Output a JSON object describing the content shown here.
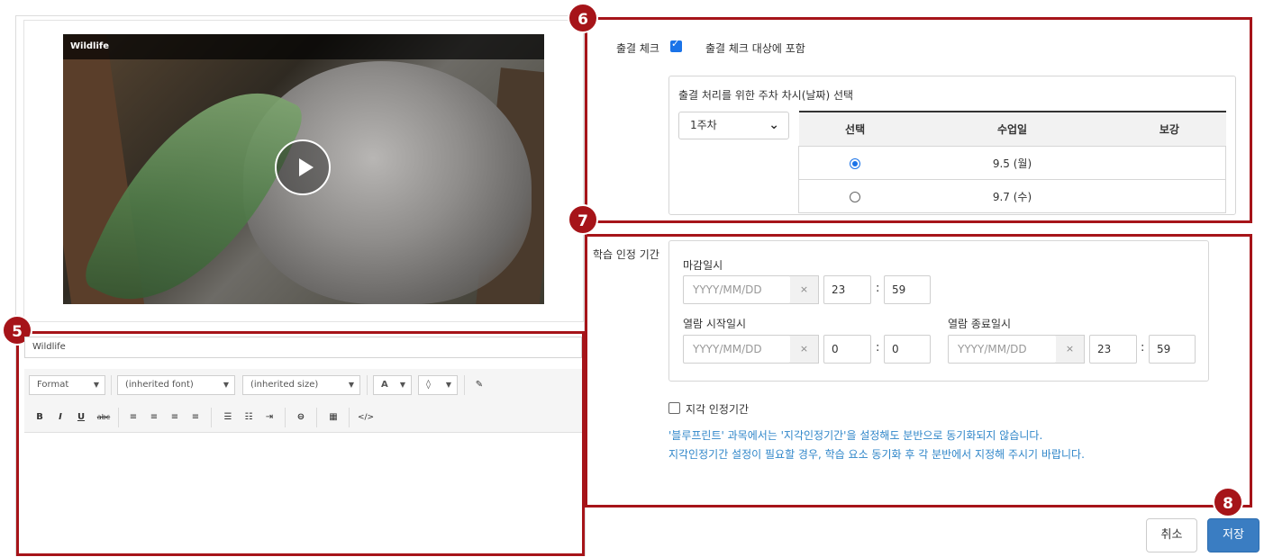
{
  "video": {
    "title": "Wildlife"
  },
  "editor": {
    "title_value": "Wildlife",
    "format_label": "Format",
    "font_label": "(inherited font)",
    "size_label": "(inherited size)",
    "text_color_label": "A",
    "bold": "B",
    "italic": "I",
    "underline": "U",
    "strike": "abc",
    "source": "</>"
  },
  "callouts": {
    "five": "5",
    "six": "6",
    "seven": "7",
    "eight": "8"
  },
  "attendance": {
    "label": "출결 체크",
    "checkbox_label": "출결 체크 대상에 포함",
    "checked": true,
    "week_section_title": "출결 처리를 위한 주차 차시(날짜) 선택",
    "week_selected": "1주차",
    "columns": [
      "선택",
      "수업일",
      "보강"
    ],
    "rows": [
      {
        "selected": true,
        "date": "9.5 (월)",
        "makeup": ""
      },
      {
        "selected": false,
        "date": "9.7 (수)",
        "makeup": ""
      }
    ]
  },
  "period": {
    "label": "학습 인정 기간",
    "deadline_label": "마감일시",
    "date_placeholder": "YYYY/MM/DD",
    "clear_symbol": "×",
    "deadline_hour": "23",
    "deadline_minute": "59",
    "open_start_label": "열람 시작일시",
    "open_start_hour": "0",
    "open_start_minute": "0",
    "open_end_label": "열람 종료일시",
    "open_end_hour": "23",
    "open_end_minute": "59",
    "colon": ":",
    "late_label": "지각 인정기간",
    "late_checked": false,
    "note_line1": "'블루프린트' 과목에서는 '지각인정기간'을 설정해도 분반으로 동기화되지 않습니다.",
    "note_line2": "지각인정기간 설정이 필요할 경우, 학습 요소 동기화 후 각 분반에서 지정해 주시기 바랍니다."
  },
  "buttons": {
    "cancel": "취소",
    "save": "저장"
  },
  "colors": {
    "callout_red": "#a61419",
    "accent_blue": "#3a7dc2",
    "note_blue": "#2f86c9"
  }
}
